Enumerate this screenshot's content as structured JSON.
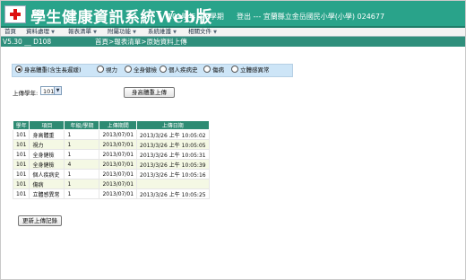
{
  "header": {
    "app_title": "學生健康資訊系統",
    "app_title_web": "Web版",
    "term": "101學年 第2學期",
    "login_info": "登出 --- 宜蘭縣立金岳國民小學(小學) 024677"
  },
  "menu": [
    {
      "label": "首頁"
    },
    {
      "label": "資料處理"
    },
    {
      "label": "報表清單"
    },
    {
      "label": "附屬功能"
    },
    {
      "label": "系統維護"
    },
    {
      "label": "相關文件"
    }
  ],
  "infobar": {
    "version": "V5.30 __ D108",
    "breadcrumb": "首頁>報表清單>原始資料上傳"
  },
  "data_types": {
    "selected": "身高體重(含生長遲緩)",
    "options": [
      "身高體重(含生長遲緩)",
      "視力",
      "全身健檢",
      "個人疾病史",
      "傷病",
      "立體感異常"
    ]
  },
  "upload_form": {
    "year_label": "上傳學年:",
    "year_value": "101",
    "upload_button": "身高體重上傳"
  },
  "records": {
    "columns": [
      "學年",
      "項目",
      "年級/學期",
      "上傳期間",
      "上傳日期"
    ],
    "rows": [
      [
        "101",
        "身高體重",
        "1",
        "2013/07/01",
        "2013/3/26 上午 10:05:02"
      ],
      [
        "101",
        "視力",
        "1",
        "2013/07/01",
        "2013/3/26 上午 10:05:05"
      ],
      [
        "101",
        "全身健檢",
        "1",
        "2013/07/01",
        "2013/3/26 上午 10:05:31"
      ],
      [
        "101",
        "全身健檢",
        "4",
        "2013/07/01",
        "2013/3/26 上午 10:05:39"
      ],
      [
        "101",
        "個人疾病史",
        "1",
        "2013/07/01",
        "2013/3/26 上午 10:05:16"
      ],
      [
        "101",
        "傷病",
        "1",
        "2013/07/01",
        ""
      ],
      [
        "101",
        "立體感異常",
        "1",
        "2013/07/01",
        "2013/3/26 上午 10:05:25"
      ]
    ],
    "more_button": "更新上傳記錄"
  }
}
